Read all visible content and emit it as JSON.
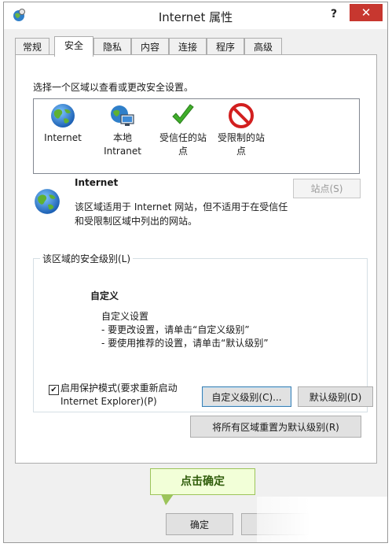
{
  "window": {
    "title": "Internet 属性",
    "help_label": "?",
    "close_label": "✕"
  },
  "tabs": [
    {
      "label": "常规"
    },
    {
      "label": "安全"
    },
    {
      "label": "隐私"
    },
    {
      "label": "内容"
    },
    {
      "label": "连接"
    },
    {
      "label": "程序"
    },
    {
      "label": "高级"
    }
  ],
  "active_tab": "安全",
  "security": {
    "zone_prompt": "选择一个区域以查看或更改安全设置。",
    "zones": [
      {
        "line1": "Internet",
        "line2": "",
        "icon": "globe-icon"
      },
      {
        "line1": "本地",
        "line2": "Intranet",
        "icon": "local-intranet-icon"
      },
      {
        "line1": "受信任的站",
        "line2": "点",
        "icon": "checkmark-icon"
      },
      {
        "line1": "受限制的站",
        "line2": "点",
        "icon": "restricted-icon"
      }
    ],
    "selected_zone": {
      "title": "Internet",
      "desc_line1": "该区域适用于 Internet 网站，但不适用于在受信任",
      "desc_line2": "和受限制区域中列出的网站。",
      "sites_button": "站点(S)"
    },
    "level_group": {
      "label": "该区域的安全级别(L)",
      "level_title": "自定义",
      "lines": [
        "自定义设置",
        "- 要更改设置，请单击“自定义级别”",
        "- 要使用推荐的设置，请单击“默认级别”"
      ],
      "protected_mode_checked": true,
      "protected_mode_line1": "启用保护模式(要求重新启动",
      "protected_mode_line2": "Internet Explorer)(P)",
      "custom_level_button": "自定义级别(C)...",
      "default_level_button": "默认级别(D)"
    },
    "reset_all_button": "将所有区域重置为默认级别(R)"
  },
  "annotation": {
    "callout_text": "点击确定"
  },
  "footer": {
    "ok_button": "确定"
  },
  "colors": {
    "close_button": "#c7372f",
    "callout_bg": "#f2ffd8",
    "callout_text": "#2f5c0a"
  }
}
